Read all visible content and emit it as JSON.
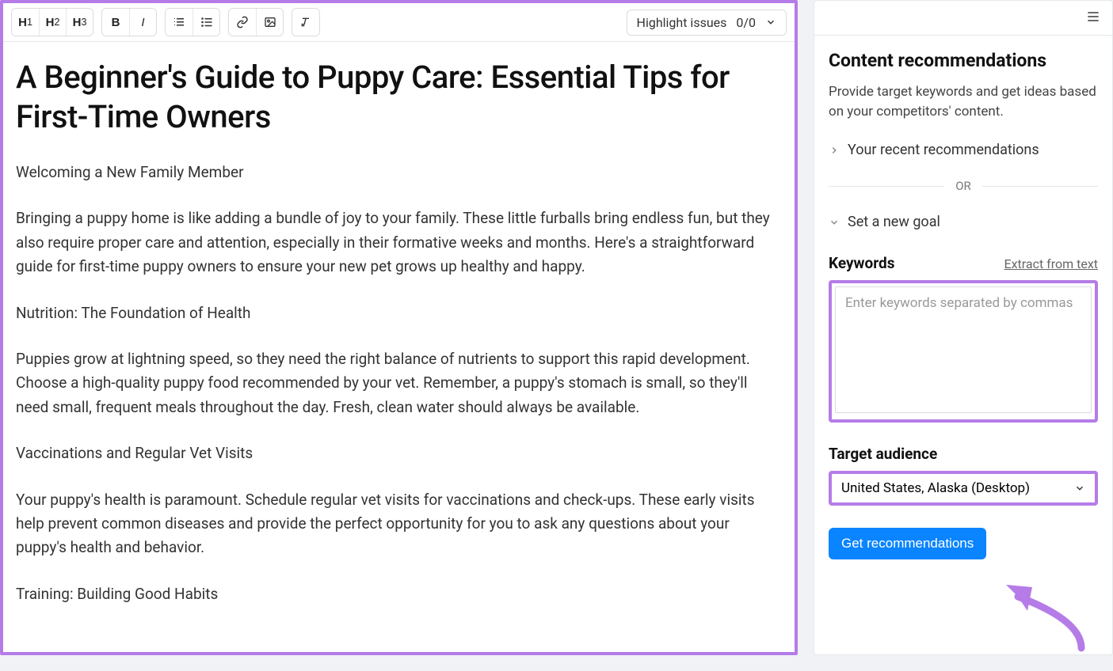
{
  "toolbar": {
    "highlight_label": "Highlight issues",
    "highlight_count": "0/0"
  },
  "editor": {
    "title": "A Beginner's Guide to Puppy Care: Essential Tips for First-Time Owners",
    "p1": "Welcoming a New Family Member",
    "p2": "Bringing a puppy home is like adding a bundle of joy to your family. These little furballs bring endless fun, but they also require proper care and attention, especially in their formative weeks and months. Here's a straightforward guide for first-time puppy owners to ensure your new pet grows up healthy and happy.",
    "p3": "Nutrition: The Foundation of Health",
    "p4": "Puppies grow at lightning speed, so they need the right balance of nutrients to support this rapid development. Choose a high-quality puppy food recommended by your vet. Remember, a puppy's stomach is small, so they'll need small, frequent meals throughout the day. Fresh, clean water should always be available.",
    "p5": "Vaccinations and Regular Vet Visits",
    "p6": "Your puppy's health is paramount. Schedule regular vet visits for vaccinations and check-ups. These early visits help prevent common diseases and provide the perfect opportunity for you to ask any questions about your puppy's health and behavior.",
    "p7": "Training: Building Good Habits"
  },
  "sidebar": {
    "heading": "Content recommendations",
    "subheading": "Provide target keywords and get ideas based on your competitors' content.",
    "recent_label": "Your recent recommendations",
    "or_label": "OR",
    "new_goal_label": "Set a new goal",
    "keywords_label": "Keywords",
    "extract_label": "Extract from text",
    "keywords_placeholder": "Enter keywords separated by commas",
    "target_audience_label": "Target audience",
    "target_audience_value": "United States, Alaska (Desktop)",
    "get_button": "Get recommendations"
  }
}
